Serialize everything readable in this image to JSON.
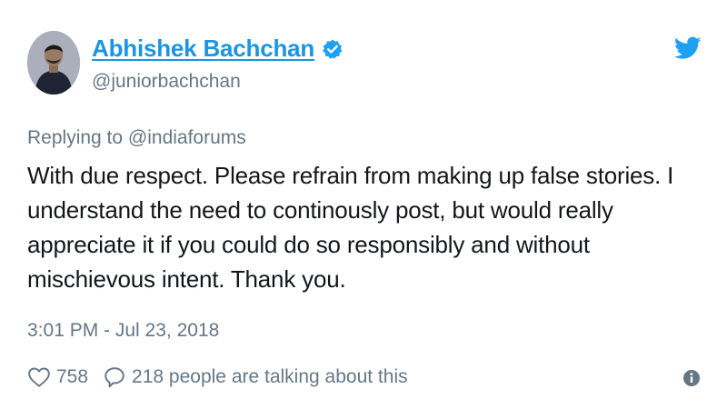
{
  "author": {
    "display_name": "Abhishek Bachchan",
    "handle": "@juniorbachchan",
    "verified": true
  },
  "reply": {
    "prefix": "Replying to",
    "handle": "@indiaforums"
  },
  "tweet": {
    "lines": [
      "With due respect. Please refrain from making up false stories. I",
      "understand the need to continously post, but would really",
      "appreciate it if you could do so responsibly and without",
      "mischievous intent. Thank you."
    ]
  },
  "timestamp": "3:01 PM - Jul 23, 2018",
  "stats": {
    "likes": "758",
    "talking": "218 people are talking about this"
  },
  "icons": {
    "like": "heart-icon",
    "reply": "speech-bubble-icon",
    "info": "info-icon",
    "brand": "twitter-bird-icon",
    "verified": "verified-badge-icon"
  },
  "colors": {
    "brand": "#1da1f2",
    "link": "#1b95e0",
    "text": "#14171a",
    "muted": "#657786"
  }
}
